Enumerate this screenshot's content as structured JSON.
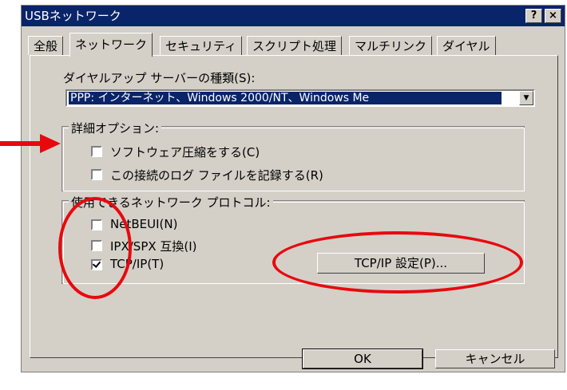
{
  "window": {
    "title": "USBネットワーク",
    "help_label": "?",
    "close_label": "×"
  },
  "tabs": [
    {
      "label": "全般"
    },
    {
      "label": "ネットワーク"
    },
    {
      "label": "セキュリティ"
    },
    {
      "label": "スクリプト処理"
    },
    {
      "label": "マルチリンク"
    },
    {
      "label": "ダイヤル"
    }
  ],
  "server_type": {
    "label": "ダイヤルアップ サーバーの種類(S):",
    "selected": "PPP: インターネット、Windows 2000/NT、Windows Me"
  },
  "advanced": {
    "title": "詳細オプション:",
    "options": [
      {
        "label": "ソフトウェア圧縮をする(C)",
        "checked": false
      },
      {
        "label": "この接続のログ ファイルを記録する(R)",
        "checked": false
      }
    ]
  },
  "protocols": {
    "title": "使用できるネットワーク プロトコル:",
    "items": [
      {
        "label": "NetBEUI(N)",
        "checked": false
      },
      {
        "label": "IPX/SPX 互換(I)",
        "checked": false
      },
      {
        "label": "TCP/IP(T)",
        "checked": true
      }
    ],
    "tcpip_settings_label": "TCP/IP 設定(P)..."
  },
  "footer": {
    "ok_label": "OK",
    "cancel_label": "キャンセル"
  },
  "annotation_color": "#e8090f"
}
